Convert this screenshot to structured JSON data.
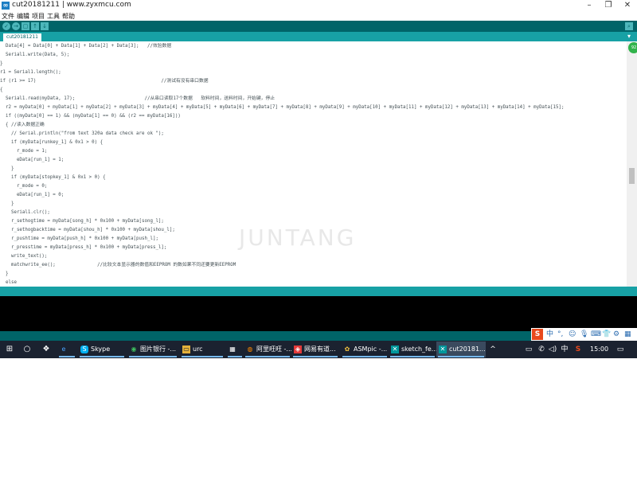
{
  "window": {
    "title": "cut20181211 | www.zyxmcu.com",
    "app_icon": "arduino-icon",
    "minimize": "–",
    "restore": "❐",
    "close": "✕"
  },
  "menu": [
    "文件",
    "编辑",
    "项目",
    "工具",
    "帮助"
  ],
  "toolbar": {
    "verify": "✓",
    "upload": "→",
    "new": "▢",
    "open": "↑",
    "save": "↓",
    "serial_monitor": "⌕"
  },
  "tabs": [
    {
      "label": "cut20181211"
    }
  ],
  "tab_menu": "▾",
  "code_lines": [
    "  Data[4] = Data[0] + Data[1] + Data[2] + Data[3];   //效验数据",
    "  Serial1.write(Data, 5);",
    "}",
    "r1 = Serial1.length();",
    "if (r1 >= 17)                                             //测试有没有串口数据",
    "{",
    "  Serial1.read(myData, 17);                         //从串口读取17个数据   软料时间，送料时间，开始键，停止",
    "  r2 = myData[0] + myData[1] + myData[2] + myData[3] + myData[4] + myData[5] + myData[6] + myData[7] + myData[8] + myData[9] + myData[10] + myData[11] + myData[12] + myData[13] + myData[14] + myData[15];",
    "  if ((myData[0] == 1) && (myData[1] == 0) && (r2 == myData[16]))",
    "  { //读入数据正确",
    "    // Serial.println(\"from text 320a data check are ok \");",
    "    if (myData[runkey_1] & 0x1 > 0) {",
    "      r_mode = 1;",
    "      eData[run_1] = 1;",
    "    }",
    "    if (myData[stopkey_1] & 0x1 > 0) {",
    "      r_mode = 0;",
    "      eData[run_1] = 0;",
    "    }",
    "    Serial1.clr();",
    "    r_sethogtime = myData[song_h] * 0x100 + myData[song_l];",
    "    r_sethogbacktime = myData[shou_h] * 0x100 + myData[shou_l];",
    "    r_pushtime = myData[push_h] * 0x100 + myData[push_l];",
    "    r_presstime = myData[press_h] * 0x100 + myData[press_l];",
    "    write_text();",
    "    matchwrite_ee();               //比较文本显示器的数值和EEPROM 的数如果不同还要更新EEPROM",
    "  }",
    "  else",
    "  {",
    "    // ...                              ..."
  ],
  "watermark": "JUNTANG",
  "float_badge": "92",
  "ime": {
    "logo": "S",
    "items": [
      "中",
      "°,",
      "☺",
      "🎙",
      "⌨",
      "👕",
      "⚙",
      "▦"
    ]
  },
  "taskbar": {
    "start": "⊞",
    "search": "○",
    "taskview": "❖",
    "tasks": [
      {
        "label": "",
        "icon": "e"
      },
      {
        "label": "Skype",
        "icon": "S"
      },
      {
        "label": "图片银行 -...",
        "icon": "◉"
      },
      {
        "label": "urc",
        "icon": "▭"
      },
      {
        "label": "",
        "icon": "▦"
      },
      {
        "label": "阿里旺旺 -...",
        "icon": "◍"
      },
      {
        "label": "网易有道...",
        "icon": "◈"
      },
      {
        "label": "ASMpic -...",
        "icon": "✿"
      },
      {
        "label": "sketch_fe...",
        "icon": "✕"
      },
      {
        "label": "cut20181...",
        "icon": "✕"
      }
    ],
    "tray": [
      "^",
      "▭",
      "✆",
      "◁)",
      "中",
      "S"
    ],
    "clock": "15:00",
    "notification": "▭"
  }
}
